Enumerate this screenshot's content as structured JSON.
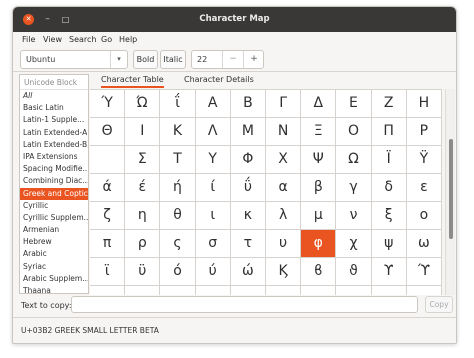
{
  "window": {
    "title": "Character Map"
  },
  "menu": [
    "File",
    "View",
    "Search",
    "Go",
    "Help"
  ],
  "toolbar": {
    "font_value": "Ubuntu",
    "bold_label": "Bold",
    "italic_label": "Italic",
    "size_value": "22",
    "minus_label": "−",
    "plus_label": "+"
  },
  "sidebar": {
    "header": "Unicode Block",
    "items": [
      "All",
      "Basic Latin",
      "Latin-1 Supple...",
      "Latin Extended-A",
      "Latin Extended-B",
      "IPA Extensions",
      "Spacing Modifie...",
      "Combining Diac...",
      "Greek and Coptic",
      "Cyrillic",
      "Cyrillic Supplem...",
      "Armenian",
      "Hebrew",
      "Arabic",
      "Syriac",
      "Arabic Supplem...",
      "Thaana"
    ],
    "selected_index": 8
  },
  "tabs": [
    "Character Table",
    "Character Details"
  ],
  "grid": {
    "selected": [
      5,
      6
    ],
    "rows": [
      [
        "Ύ",
        "Ώ",
        "ΐ",
        "Α",
        "Β",
        "Γ",
        "Δ",
        "Ε",
        "Ζ",
        "Η"
      ],
      [
        "Θ",
        "Ι",
        "Κ",
        "Λ",
        "Μ",
        "Ν",
        "Ξ",
        "Ο",
        "Π",
        "Ρ"
      ],
      [
        "",
        "Σ",
        "Τ",
        "Υ",
        "Φ",
        "Χ",
        "Ψ",
        "Ω",
        "Ϊ",
        "Ϋ"
      ],
      [
        "ά",
        "έ",
        "ή",
        "ί",
        "ΰ",
        "α",
        "β",
        "γ",
        "δ",
        "ε"
      ],
      [
        "ζ",
        "η",
        "θ",
        "ι",
        "κ",
        "λ",
        "μ",
        "ν",
        "ξ",
        "ο"
      ],
      [
        "π",
        "ρ",
        "ς",
        "σ",
        "τ",
        "υ",
        "φ",
        "χ",
        "ψ",
        "ω"
      ],
      [
        "ϊ",
        "ϋ",
        "ό",
        "ύ",
        "ώ",
        "Ϗ",
        "ϐ",
        "ϑ",
        "ϒ",
        "ϓ"
      ],
      [
        "",
        "",
        "",
        "",
        "",
        "",
        "",
        "",
        "",
        ""
      ]
    ]
  },
  "copy": {
    "label": "Text to copy:",
    "button_label": "Copy",
    "value": ""
  },
  "status": "U+03B2 GREEK SMALL LETTER BETA"
}
